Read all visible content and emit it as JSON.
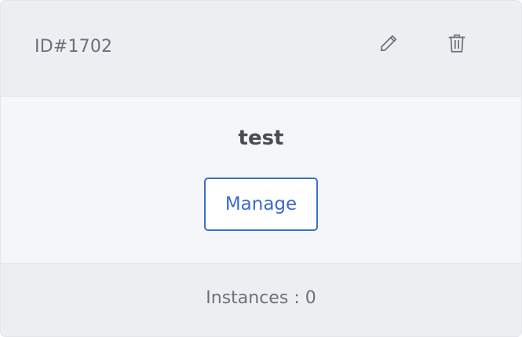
{
  "card": {
    "id_label": "ID#1702",
    "title": "test",
    "manage_label": "Manage",
    "instances_label": "Instances",
    "instances_separator": ":",
    "instances_count": "0"
  },
  "icons": {
    "edit": "pencil-icon",
    "delete": "trash-icon"
  },
  "colors": {
    "accent": "#3d6fcc",
    "text_muted": "#6c7079",
    "title": "#474c55",
    "header_bg": "#edeef1",
    "body_bg": "#f5f6f9"
  }
}
